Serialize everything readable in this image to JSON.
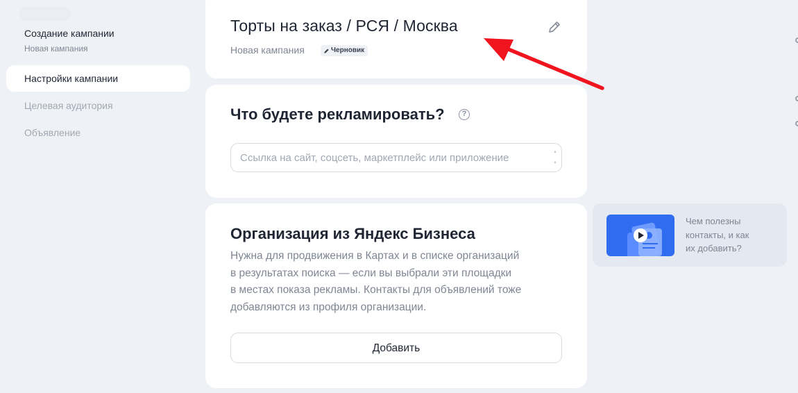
{
  "sidebar": {
    "title": "Создание кампании",
    "subtitle": "Новая кампания",
    "items": [
      {
        "label": "Настройки кампании",
        "active": true
      },
      {
        "label": "Целевая аудитория",
        "active": false
      },
      {
        "label": "Объявление",
        "active": false
      }
    ]
  },
  "campaign": {
    "title": "Торты на заказ / РСЯ / Москва",
    "subtitle": "Новая кампания",
    "badge": "Черновик",
    "edit_icon": "pencil-icon"
  },
  "advertise": {
    "title": "Что будете рекламировать?",
    "help_icon": "question-circle-icon",
    "input_placeholder": "Ссылка на сайт, соцсеть, маркетплейс или приложение",
    "input_value": ""
  },
  "organization": {
    "title": "Организация из Яндекс Бизнеса",
    "description_lines": [
      "Нужна для продвижения в Картах и в списке организаций",
      "в результатах поиска — если вы выбрали эти площадки",
      "в местах показа рекламы. Контакты для объявлений тоже",
      "добавляются из профиля организации."
    ],
    "add_button": "Добавить"
  },
  "help_video": {
    "lines": [
      "Чем полезны",
      "контакты, и как",
      "их добавить?"
    ],
    "thumb_icon": "play-icon"
  },
  "colors": {
    "background": "#eef1f6",
    "card": "#ffffff",
    "accent_blue": "#2f6cf0",
    "annotation_arrow": "#f0141e",
    "muted_text": "#7f8693"
  }
}
